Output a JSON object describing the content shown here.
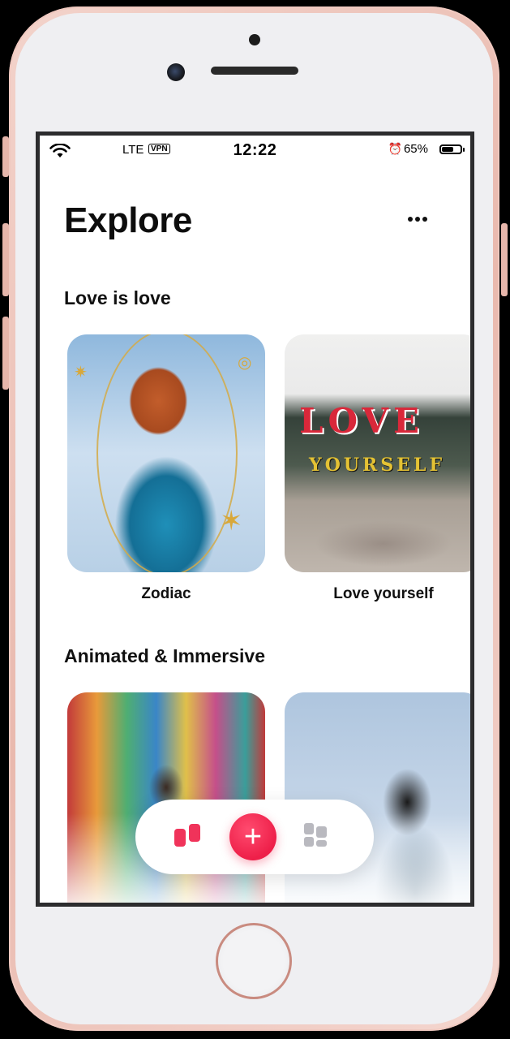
{
  "status_bar": {
    "carrier": "LTE",
    "vpn": "VPN",
    "time": "12:22",
    "battery": "65%",
    "battery_level": 0.65,
    "icons": [
      "wifi-icon",
      "alarm-icon",
      "battery-icon"
    ]
  },
  "header": {
    "title": "Explore",
    "more_icon": "more-horizontal-icon"
  },
  "sections": [
    {
      "title": "Love is love",
      "cards": [
        {
          "label": "Zodiac"
        },
        {
          "label": "Love yourself",
          "collage_top": "LOVE",
          "collage_bottom": "YOURSELF"
        }
      ]
    },
    {
      "title": "Animated & Immersive",
      "cards": [
        {
          "label": ""
        },
        {
          "label": ""
        }
      ]
    }
  ],
  "bottom_nav": {
    "items": [
      {
        "icon": "explore-icon",
        "active": true,
        "color": "#f0335a"
      },
      {
        "icon": "add-icon",
        "glyph": "+",
        "color": "#ee1f49"
      },
      {
        "icon": "library-icon",
        "active": false,
        "color": "#b9b9bf"
      }
    ]
  }
}
